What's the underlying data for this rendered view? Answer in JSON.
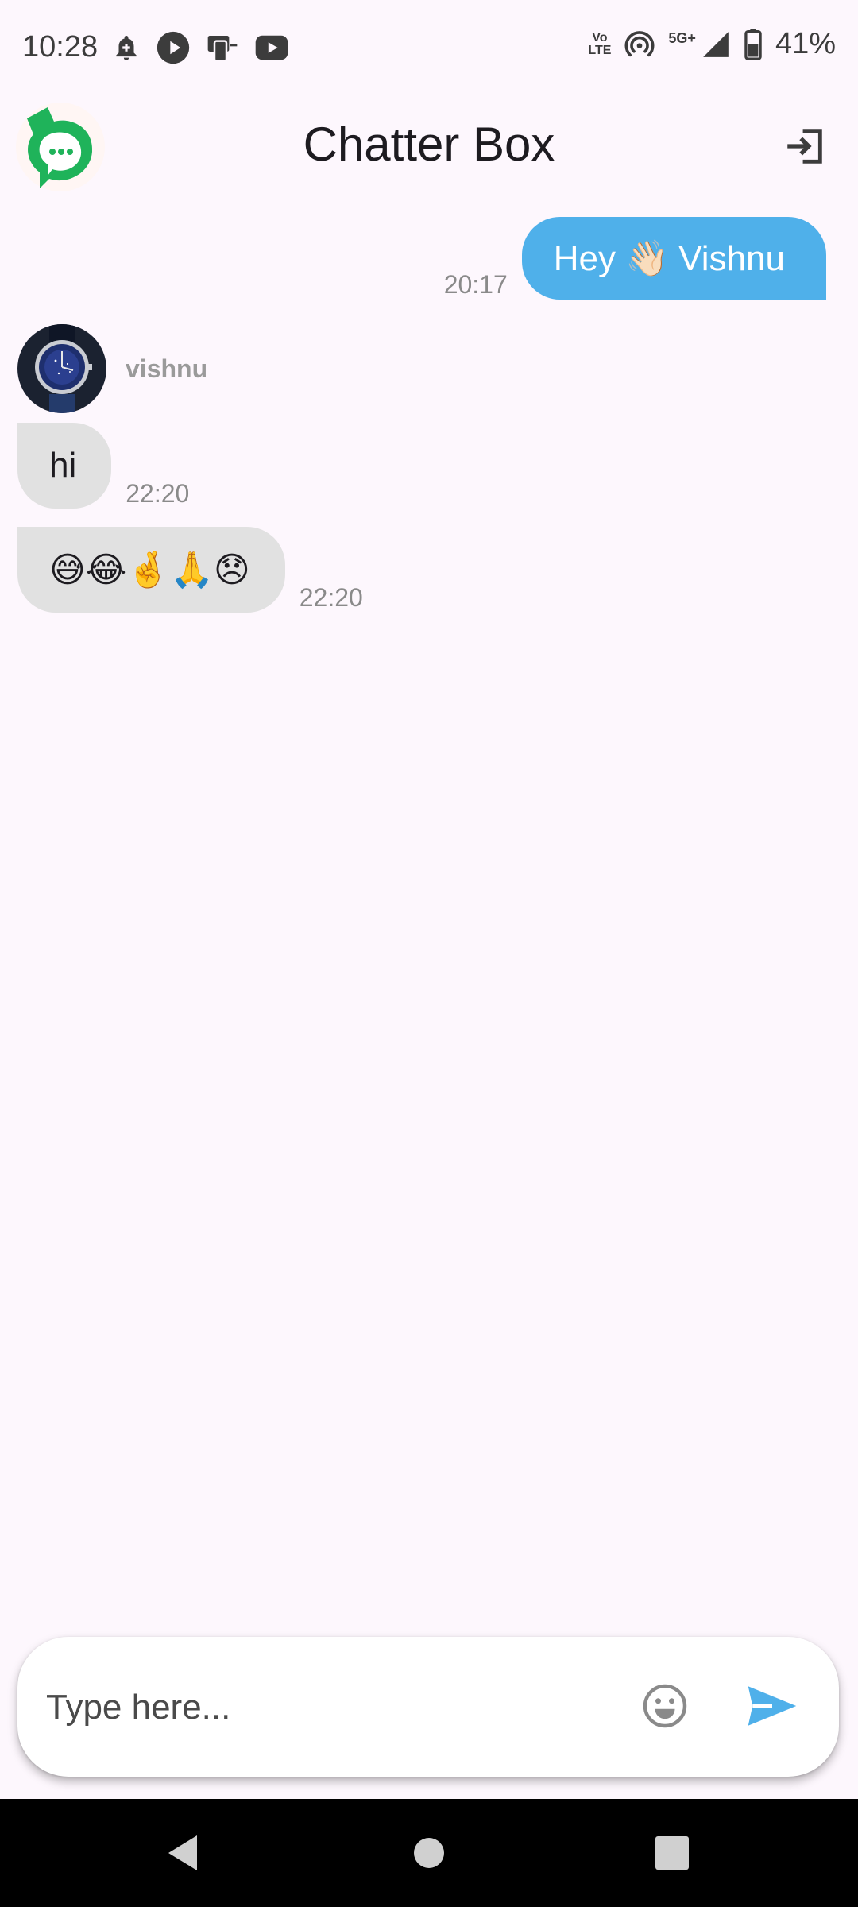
{
  "status_bar": {
    "time": "10:28",
    "left_icons": [
      "notification-bell-icon",
      "play-icon",
      "device-transfer-icon",
      "youtube-icon"
    ],
    "volte_line1": "Vo",
    "volte_line2": "LTE",
    "network_type": "5G+",
    "battery_percent": "41%"
  },
  "app_bar": {
    "title": "Chatter Box",
    "logo_icon": "chat-bubble-logo-icon",
    "logout_icon": "logout-icon"
  },
  "messages": {
    "outgoing": [
      {
        "text": "Hey 👋🏻 Vishnu",
        "time": "20:17"
      }
    ],
    "sender": {
      "name": "vishnu",
      "avatar_icon": "watch-avatar"
    },
    "incoming": [
      {
        "text": "hi",
        "time": "22:20"
      },
      {
        "text": "😅😂🤞🙏😞",
        "time": "22:20"
      }
    ]
  },
  "composer": {
    "placeholder": "Type here...",
    "value": "",
    "emoji_icon": "emoji-smile-icon",
    "send_icon": "send-icon"
  },
  "colors": {
    "background": "#fdf7fd",
    "outgoing_bubble": "#4fb0ea",
    "incoming_bubble": "#e1e1e1",
    "accent": "#4fb0ea",
    "logo_green": "#1fb35a"
  }
}
